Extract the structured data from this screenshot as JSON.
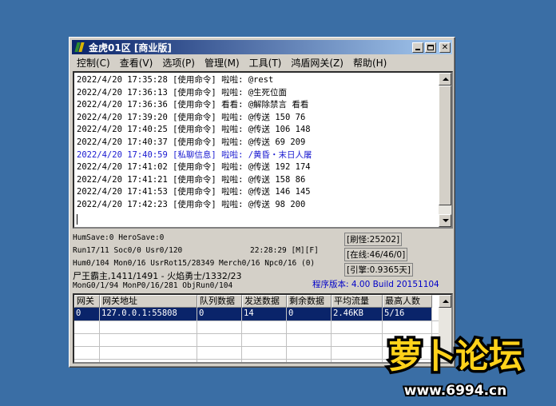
{
  "window": {
    "title": "金虎01区 [商业版]"
  },
  "menu": [
    "控制(C)",
    "查看(V)",
    "选项(P)",
    "管理(M)",
    "工具(T)",
    "鸿盾网关(Z)",
    "帮助(H)"
  ],
  "log": [
    "2022/4/20 17:35:28 [使用命令] 啦啦: @rest",
    "2022/4/20 17:36:13 [使用命令] 啦啦: @生死位面",
    "2022/4/20 17:36:36 [使用命令] 看看: @解除禁言 看看",
    "2022/4/20 17:39:20 [使用命令] 啦啦: @传送 150 76",
    "2022/4/20 17:40:25 [使用命令] 啦啦: @传送 106 148",
    "2022/4/20 17:40:37 [使用命令] 啦啦: @传送 69 209",
    "2022/4/20 17:40:59 [私聊信息] 啦啦: /黄昏・末日人屠",
    "2022/4/20 17:41:02 [使用命令] 啦啦: @传送 192 174",
    "2022/4/20 17:41:21 [使用命令] 啦啦: @传送 158 86",
    "2022/4/20 17:41:53 [使用命令] 啦啦: @传送 146 145",
    "2022/4/20 17:42:23 [使用命令] 啦啦: @传送 98 200"
  ],
  "status": {
    "save": "HumSave:0 HeroSave:0",
    "run": "Run17/11 Soc0/0 Usr0/120",
    "clock": "22:28:29 [M][F]",
    "hum": "Hum0/104 Mon0/16 UsrRot15/28349 Merch0/16 Npc0/16 (0)",
    "king": "尸王霸主,1411/1491 - 火焰勇士/1332/23",
    "mon": "MonG0/1/94 MonP0/16/281 ObjRun0/104",
    "refresh": "[刷怪:25202]",
    "online": "[在线:46/46/0]",
    "engine": "[引擎:0.9365天]",
    "version": "程序版本: 4.00 Build 20151104"
  },
  "gateway": {
    "columns": [
      "网关",
      "网关地址",
      "队列数据",
      "发送数据",
      "剩余数据",
      "平均流量",
      "最高人数"
    ],
    "rows": [
      [
        "0",
        "127.0.0.1:55808",
        "0",
        "14",
        "0",
        "2.46KB",
        "5/16"
      ]
    ]
  },
  "watermark": {
    "brand": "萝卜论坛",
    "url": "www.6994.cn"
  }
}
